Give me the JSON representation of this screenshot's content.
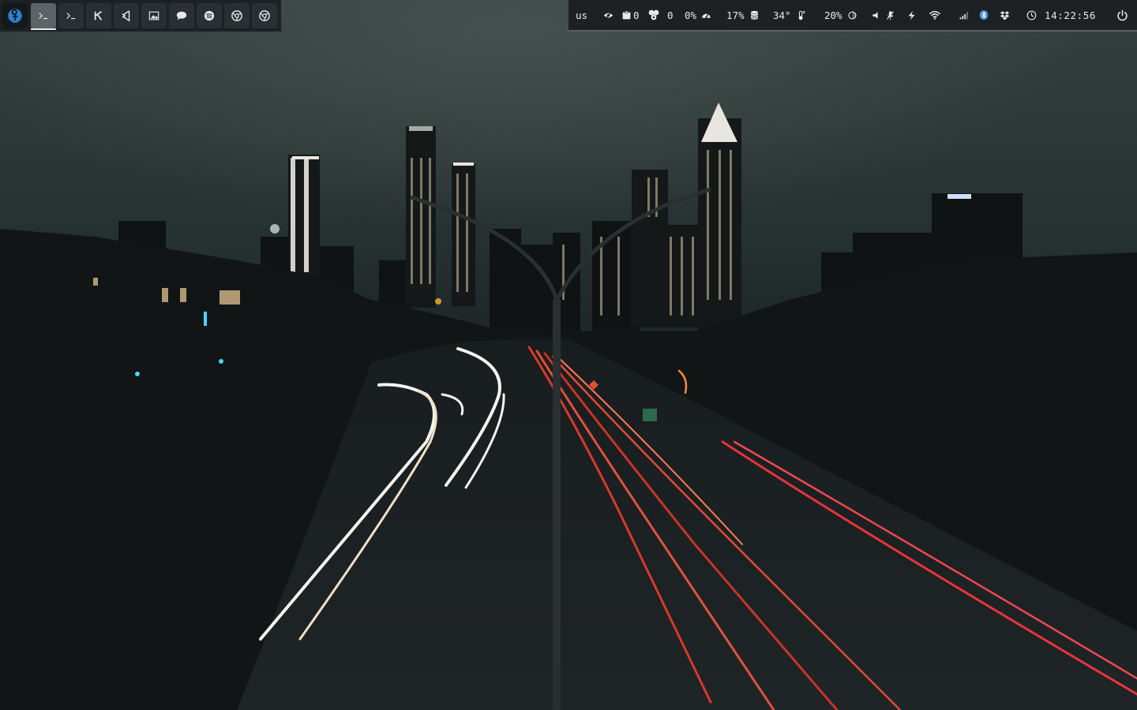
{
  "taskbar": {
    "launcher_icon": "fedora-icon",
    "apps": [
      {
        "icon": "terminal-icon",
        "active": true
      },
      {
        "icon": "terminal-icon",
        "active": false
      },
      {
        "icon": "kitty-icon",
        "active": false
      },
      {
        "icon": "vscode-icon",
        "active": false
      },
      {
        "icon": "image-viewer-icon",
        "active": false
      },
      {
        "icon": "chat-icon",
        "active": false
      },
      {
        "icon": "spotify-icon",
        "active": false
      },
      {
        "icon": "chrome-icon",
        "active": false
      },
      {
        "icon": "chrome-icon",
        "active": false
      }
    ]
  },
  "status": {
    "keyboard_layout": "us",
    "clipboard_count": "0",
    "updates_count": "0",
    "cpu": "0%",
    "memory": "17%",
    "temperature": "34°",
    "brightness": "20%",
    "clock": "14:22:56"
  },
  "colors": {
    "bar_bg": "#1d2124",
    "active_app": "#5d6468",
    "text": "#e8eaec",
    "bluetooth": "#4a8fe0"
  }
}
